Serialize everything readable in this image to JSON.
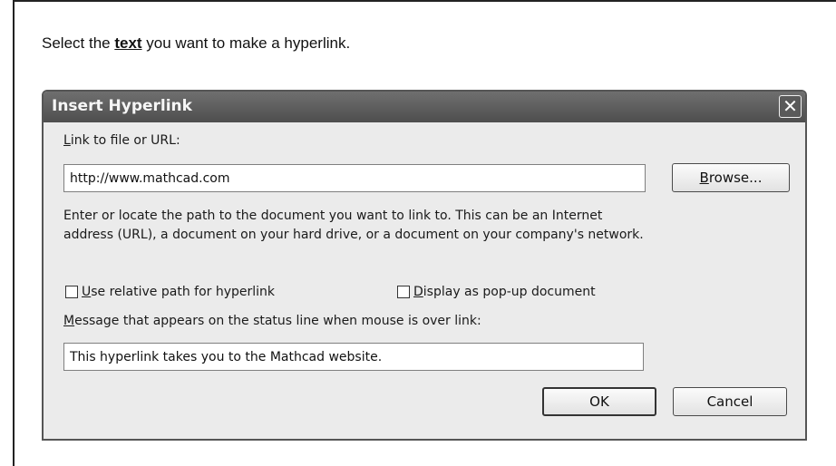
{
  "instruction": {
    "before": "Select the ",
    "emphasis": "text",
    "after": " you want to make a hyperlink."
  },
  "dialog": {
    "title": "Insert Hyperlink",
    "close_glyph": "✕",
    "link_label": {
      "mnemonic": "L",
      "rest": "ink to file or URL:"
    },
    "url_value": "http://www.mathcad.com",
    "browse_button": {
      "mnemonic": "B",
      "rest": "rowse..."
    },
    "description_line1": "Enter or locate the path to the document you want to link to. This can be an Internet",
    "description_line2": "address (URL), a document on your hard drive, or a document on your company's network.",
    "relative_path": {
      "mnemonic": "U",
      "rest": "se relative path for hyperlink",
      "checked": false
    },
    "popup": {
      "mnemonic": "D",
      "rest": "isplay as pop-up document",
      "checked": false
    },
    "message_label": {
      "mnemonic": "M",
      "rest": "essage that appears on the status line when mouse is over link:"
    },
    "message_value": "This hyperlink takes you to the Mathcad website.",
    "ok_label": "OK",
    "cancel_label": "Cancel"
  },
  "colors": {
    "titlebar": "#5a5a5a",
    "dialog_bg": "#ebebeb"
  }
}
